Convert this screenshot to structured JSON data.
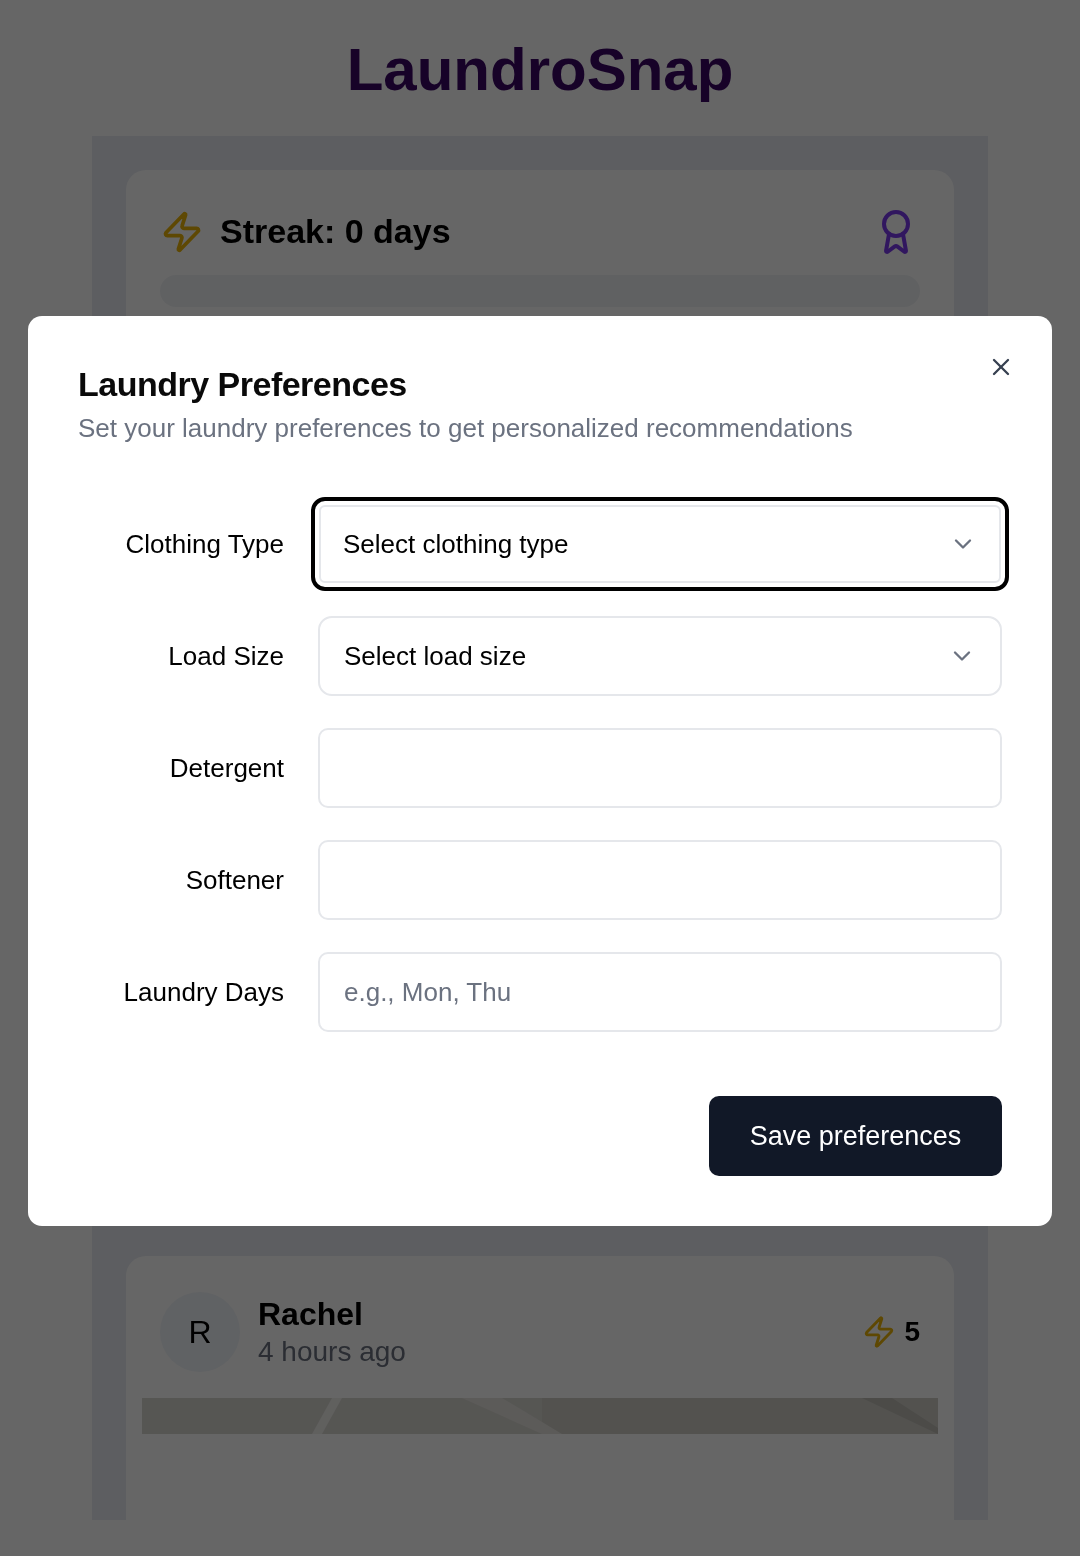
{
  "app": {
    "title": "LaundroSnap"
  },
  "streak": {
    "label": "Streak: 0 days"
  },
  "posts": [
    {
      "avatar": "R",
      "name": "Rachel",
      "time": "4 hours ago",
      "count": "5",
      "kind": "picture"
    }
  ],
  "dialog": {
    "title": "Laundry Preferences",
    "description": "Set your laundry preferences to get personalized recommendations",
    "fields": [
      {
        "label": "Clothing Type",
        "kind": "select",
        "placeholder": "Select clothing type",
        "focused": true
      },
      {
        "label": "Load Size",
        "kind": "select",
        "placeholder": "Select load size",
        "focused": false
      },
      {
        "label": "Detergent",
        "kind": "text",
        "focused": false
      },
      {
        "label": "Softener",
        "kind": "text",
        "focused": false
      },
      {
        "label": "Laundry Days",
        "kind": "text",
        "placeholder": "e.g., Mon, Thu",
        "focused": false
      }
    ],
    "save_button": "Save preferences"
  }
}
